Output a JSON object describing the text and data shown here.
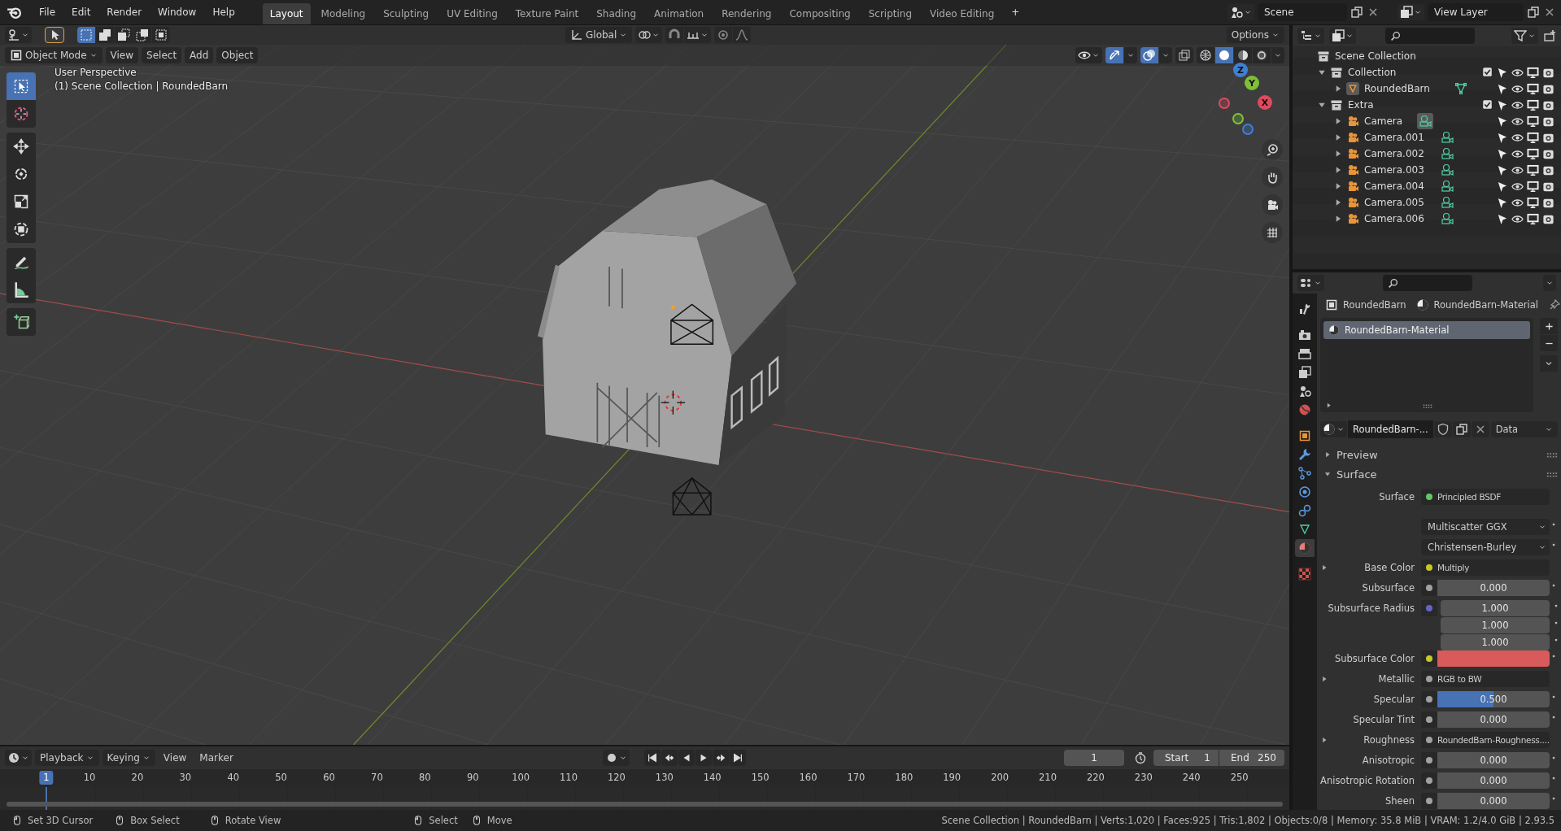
{
  "menu": [
    "File",
    "Edit",
    "Render",
    "Window",
    "Help"
  ],
  "workspaces": [
    {
      "label": "Layout",
      "selected": true
    },
    {
      "label": "Modeling",
      "selected": false
    },
    {
      "label": "Sculpting",
      "selected": false
    },
    {
      "label": "UV Editing",
      "selected": false
    },
    {
      "label": "Texture Paint",
      "selected": false
    },
    {
      "label": "Shading",
      "selected": false
    },
    {
      "label": "Animation",
      "selected": false
    },
    {
      "label": "Rendering",
      "selected": false
    },
    {
      "label": "Compositing",
      "selected": false
    },
    {
      "label": "Scripting",
      "selected": false
    },
    {
      "label": "Video Editing",
      "selected": false
    }
  ],
  "add_workspace": "+",
  "scene": {
    "value": "Scene"
  },
  "view_layer": {
    "value": "View Layer"
  },
  "viewport": {
    "select_modes": [
      {
        "selected": true
      },
      {
        "selected": false
      },
      {
        "selected": false
      },
      {
        "selected": false
      },
      {
        "selected": false
      }
    ],
    "transform_orientation": "Global",
    "options": "Options",
    "mode": "Object Mode",
    "menus": [
      "View",
      "Select",
      "Add",
      "Object"
    ],
    "gizmos_on": true,
    "overlays_on": true,
    "xray": false,
    "shading": [
      {
        "selected": false
      },
      {
        "selected": true
      },
      {
        "selected": false
      },
      {
        "selected": false
      }
    ],
    "overlay_text": [
      "User Perspective",
      "(1) Scene Collection | RoundedBarn"
    ],
    "tools": [
      {
        "selected": true
      },
      {
        "selected": false
      },
      {
        "selected": false
      },
      {
        "selected": false
      },
      {
        "selected": false
      },
      {
        "selected": false
      },
      {
        "selected": false
      },
      {
        "selected": false
      },
      {
        "selected": false
      }
    ],
    "gizmo_axes": [
      "X",
      "Y",
      "Z"
    ]
  },
  "outliner": {
    "items": [
      {
        "label": "Scene Collection",
        "kind": "scene",
        "children": [
          {
            "label": "Collection",
            "kind": "collection",
            "expanded": true,
            "checked": true,
            "children": [
              {
                "label": "RoundedBarn",
                "kind": "mesh",
                "expanded": false,
                "active": true
              }
            ]
          },
          {
            "label": "Extra",
            "kind": "collection",
            "expanded": true,
            "checked": true,
            "children": [
              {
                "label": "Camera",
                "kind": "camera",
                "expanded": false,
                "active": true
              },
              {
                "label": "Camera.001",
                "kind": "camera",
                "expanded": false,
                "active": false
              },
              {
                "label": "Camera.002",
                "kind": "camera",
                "expanded": false,
                "active": false
              },
              {
                "label": "Camera.003",
                "kind": "camera",
                "expanded": false,
                "active": false
              },
              {
                "label": "Camera.004",
                "kind": "camera",
                "expanded": false,
                "active": false
              },
              {
                "label": "Camera.005",
                "kind": "camera",
                "expanded": false,
                "active": false
              },
              {
                "label": "Camera.006",
                "kind": "camera",
                "expanded": false,
                "active": false
              }
            ]
          }
        ]
      }
    ]
  },
  "properties": {
    "tabs": [
      {
        "selected": false
      },
      {
        "selected": false
      },
      {
        "selected": false
      },
      {
        "selected": false
      },
      {
        "selected": false
      },
      {
        "selected": false
      },
      {
        "selected": false
      },
      {
        "selected": false
      },
      {
        "selected": false
      },
      {
        "selected": false
      },
      {
        "selected": false
      },
      {
        "selected": false
      },
      {
        "selected": true
      },
      {
        "selected": false
      }
    ],
    "object": "RoundedBarn",
    "material": "RoundedBarn-Material",
    "slots": [
      {
        "label": "RoundedBarn-Material",
        "selected": true
      }
    ],
    "datablock": "RoundedBarn-...",
    "link": "Data",
    "panels": [
      {
        "label": "Preview",
        "expanded": false
      },
      {
        "label": "Surface",
        "expanded": true
      }
    ],
    "rows": [
      {
        "kind": "link",
        "label": "Surface",
        "color": "#63c763",
        "value": "Principled BSDF"
      },
      {
        "kind": "dropdown",
        "value": "Multiscatter GGX"
      },
      {
        "kind": "dropdown",
        "value": "Christensen-Burley"
      },
      {
        "kind": "link",
        "label": "Base Color",
        "color": "#c7c729",
        "value": "Multiply",
        "expanded": false
      },
      {
        "kind": "number",
        "label": "Subsurface",
        "color": "#a1a1a1",
        "value": "0.000",
        "level": 0
      },
      {
        "kind": "vector",
        "label": "Subsurface Radius",
        "color": "#6363c7",
        "values": [
          "1.000",
          "1.000",
          "1.000"
        ]
      },
      {
        "kind": "swatch",
        "label": "Subsurface Color",
        "color": "#c7c729",
        "swatch": {
          "color": "#d95a5a"
        }
      },
      {
        "kind": "link",
        "label": "Metallic",
        "color": "#a1a1a1",
        "value": "RGB to BW",
        "expanded": false
      },
      {
        "kind": "number",
        "label": "Specular",
        "color": "#a1a1a1",
        "value": "0.500",
        "level": 0.5
      },
      {
        "kind": "number",
        "label": "Specular Tint",
        "color": "#a1a1a1",
        "value": "0.000",
        "level": 0
      },
      {
        "kind": "link",
        "label": "Roughness",
        "color": "#a1a1a1",
        "value": "RoundedBarn-Roughness....",
        "expanded": false
      },
      {
        "kind": "number",
        "label": "Anisotropic",
        "color": "#a1a1a1",
        "value": "0.000",
        "level": 0
      },
      {
        "kind": "number",
        "label": "Anisotropic Rotation",
        "color": "#a1a1a1",
        "value": "0.000",
        "level": 0
      },
      {
        "kind": "number",
        "label": "Sheen",
        "color": "#a1a1a1",
        "value": "0.000",
        "level": 0
      }
    ]
  },
  "timeline": {
    "menus": [
      "Playback",
      "Keying",
      "View",
      "Marker"
    ],
    "current_frame": "1",
    "start_label": "Start",
    "start": "1",
    "end_label": "End",
    "end": "250",
    "playhead": "1",
    "ruler": [
      "10",
      "20",
      "30",
      "40",
      "50",
      "60",
      "70",
      "80",
      "90",
      "100",
      "110",
      "120",
      "130",
      "140",
      "150",
      "160",
      "170",
      "180",
      "190",
      "200",
      "210",
      "220",
      "230",
      "240",
      "250"
    ]
  },
  "status_bar": {
    "hints": [
      "Set 3D Cursor",
      "Box Select",
      "Rotate View",
      "Select",
      "Move"
    ],
    "stats": "Scene Collection | RoundedBarn | Verts:1,020 | Faces:925 | Tris:1,802 | Objects:0/8 | Memory: 35.8 MiB | VRAM: 1.2/4.0 GiB | 2.93.5"
  }
}
